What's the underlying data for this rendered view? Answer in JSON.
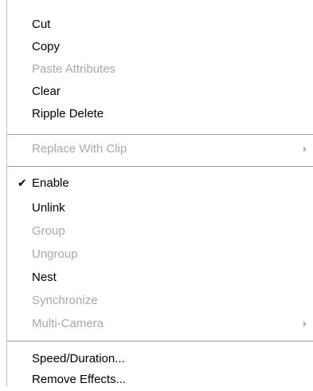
{
  "menu": {
    "cut": "Cut",
    "copy": "Copy",
    "paste_attributes": "Paste Attributes",
    "clear": "Clear",
    "ripple_delete": "Ripple Delete",
    "replace_with_clip": "Replace With Clip",
    "enable": "Enable",
    "enable_checked": true,
    "unlink": "Unlink",
    "group": "Group",
    "ungroup": "Ungroup",
    "nest": "Nest",
    "synchronize": "Synchronize",
    "multi_camera": "Multi-Camera",
    "speed_duration": "Speed/Duration...",
    "remove_effects": "Remove Effects..."
  },
  "glyphs": {
    "checkmark": "✔"
  },
  "colors": {
    "enabled_text": "#000000",
    "disabled_text": "#a8a8a8",
    "separator": "#9a9a9a"
  }
}
